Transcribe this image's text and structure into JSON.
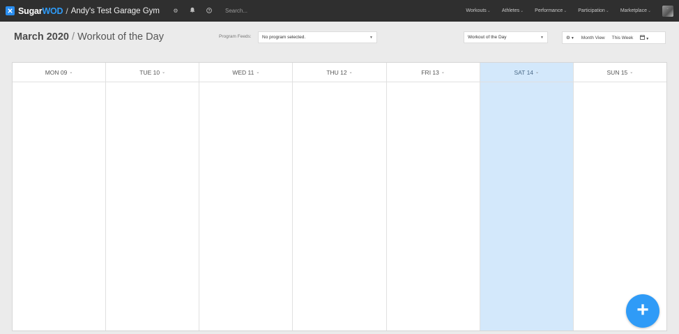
{
  "brand": {
    "name_part1": "Sugar",
    "name_part2": "WOD",
    "separator": "/",
    "gym_name": "Andy's Test Garage Gym"
  },
  "top_icons": {
    "gear": "⚙",
    "bell": "🔔",
    "help": "?"
  },
  "search": {
    "placeholder": "Search..."
  },
  "nav": {
    "items": [
      {
        "label": "Workouts"
      },
      {
        "label": "Athletes"
      },
      {
        "label": "Performance"
      },
      {
        "label": "Participation"
      },
      {
        "label": "Marketplace"
      }
    ]
  },
  "header": {
    "month": "March 2020",
    "separator": "/",
    "title": "Workout of the Day"
  },
  "program_feeds": {
    "label": "Program Feeds:",
    "value": "No program selected."
  },
  "workout_select": {
    "value": "Workout of the Day"
  },
  "view_controls": {
    "settings": "⚙",
    "month_view": "Month View",
    "this_week": "This Week",
    "calendar": "📅"
  },
  "days": [
    {
      "label": "MON 09",
      "today": false
    },
    {
      "label": "TUE 10",
      "today": false
    },
    {
      "label": "WED 11",
      "today": false
    },
    {
      "label": "THU 12",
      "today": false
    },
    {
      "label": "FRI 13",
      "today": false
    },
    {
      "label": "SAT 14",
      "today": true
    },
    {
      "label": "SUN 15",
      "today": false
    }
  ],
  "fab": {
    "symbol": "+"
  },
  "colors": {
    "accent": "#2f9bf7",
    "topbar": "#2f2f2f",
    "today_highlight": "#d3e8fb",
    "page_bg": "#ebebeb"
  }
}
